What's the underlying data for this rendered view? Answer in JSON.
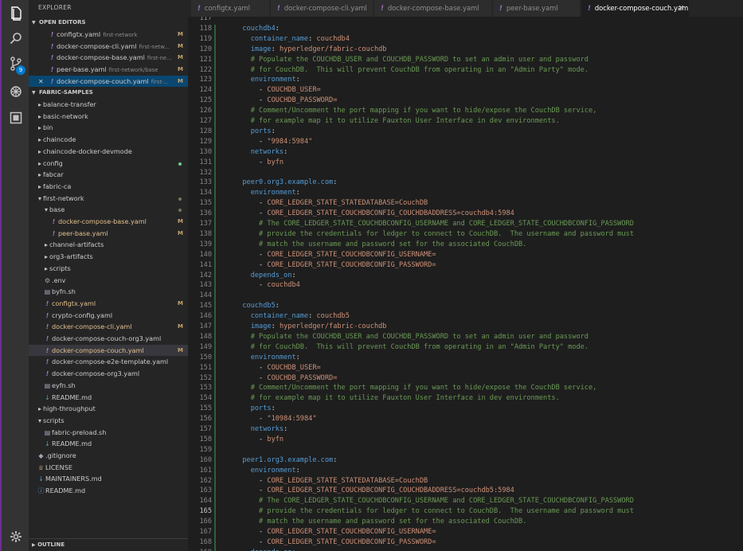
{
  "activity_bar": {
    "icons": [
      "files-icon",
      "search-icon",
      "source-control-icon",
      "debug-icon",
      "extensions-icon",
      "settings-icon"
    ],
    "scm_badge": "9"
  },
  "sidebar": {
    "title": "EXPLORER",
    "open_editors_title": "OPEN EDITORS",
    "workspace_title": "FABRIC-SAMPLES",
    "outline_title": "OUTLINE",
    "open_editors": [
      {
        "name": "configtx.yaml",
        "desc": "first-network",
        "mark": "M"
      },
      {
        "name": "docker-compose-cli.yaml",
        "desc": "first-netw...",
        "mark": "M"
      },
      {
        "name": "docker-compose-base.yaml",
        "desc": "first-ne...",
        "mark": "M"
      },
      {
        "name": "peer-base.yaml",
        "desc": "first-network/base",
        "mark": "M"
      },
      {
        "name": "docker-compose-couch.yaml",
        "desc": "first-...",
        "mark": "M"
      }
    ],
    "tree": [
      {
        "label": "balance-transfer",
        "type": "folder",
        "depth": 0,
        "tw": "›"
      },
      {
        "label": "basic-network",
        "type": "folder",
        "depth": 0,
        "tw": "›"
      },
      {
        "label": "bin",
        "type": "folder",
        "depth": 0,
        "tw": "›"
      },
      {
        "label": "chaincode",
        "type": "folder",
        "depth": 0,
        "tw": "›"
      },
      {
        "label": "chaincode-docker-devmode",
        "type": "folder",
        "depth": 0,
        "tw": "›"
      },
      {
        "label": "config",
        "type": "folder",
        "depth": 0,
        "tw": "›",
        "dot": "green"
      },
      {
        "label": "fabcar",
        "type": "folder",
        "depth": 0,
        "tw": "›"
      },
      {
        "label": "fabric-ca",
        "type": "folder",
        "depth": 0,
        "tw": "›"
      },
      {
        "label": "first-network",
        "type": "folder",
        "depth": 0,
        "tw": "⌄",
        "dot": "plain"
      },
      {
        "label": "base",
        "type": "folder",
        "depth": 1,
        "tw": "⌄",
        "dot": "plain"
      },
      {
        "label": "docker-compose-base.yaml",
        "type": "yaml",
        "depth": 2,
        "mark": "M"
      },
      {
        "label": "peer-base.yaml",
        "type": "yaml",
        "depth": 2,
        "mark": "M"
      },
      {
        "label": "channel-artifacts",
        "type": "folder",
        "depth": 1,
        "tw": "›"
      },
      {
        "label": "org3-artifacts",
        "type": "folder",
        "depth": 1,
        "tw": "›"
      },
      {
        "label": "scripts",
        "type": "folder",
        "depth": 1,
        "tw": "›"
      },
      {
        "label": ".env",
        "type": "gear",
        "depth": 1
      },
      {
        "label": "byfn.sh",
        "type": "file",
        "depth": 1
      },
      {
        "label": "configtx.yaml",
        "type": "yaml",
        "depth": 1,
        "mark": "M"
      },
      {
        "label": "crypto-config.yaml",
        "type": "yaml",
        "depth": 1
      },
      {
        "label": "docker-compose-cli.yaml",
        "type": "yaml",
        "depth": 1,
        "mark": "M"
      },
      {
        "label": "docker-compose-couch-org3.yaml",
        "type": "yaml",
        "depth": 1
      },
      {
        "label": "docker-compose-couch.yaml",
        "type": "yaml",
        "depth": 1,
        "mark": "M",
        "selected": true
      },
      {
        "label": "docker-compose-e2e-template.yaml",
        "type": "yaml",
        "depth": 1
      },
      {
        "label": "docker-compose-org3.yaml",
        "type": "yaml",
        "depth": 1
      },
      {
        "label": "eyfn.sh",
        "type": "file",
        "depth": 1
      },
      {
        "label": "README.md",
        "type": "md",
        "depth": 1
      },
      {
        "label": "high-throughput",
        "type": "folder",
        "depth": 0,
        "tw": "›"
      },
      {
        "label": "scripts",
        "type": "folder",
        "depth": 0,
        "tw": "⌄"
      },
      {
        "label": "fabric-preload.sh",
        "type": "file",
        "depth": 1
      },
      {
        "label": "README.md",
        "type": "md",
        "depth": 1
      },
      {
        "label": ".gitignore",
        "type": "git",
        "depth": 0
      },
      {
        "label": "LICENSE",
        "type": "lic",
        "depth": 0
      },
      {
        "label": "MAINTAINERS.md",
        "type": "md",
        "depth": 0
      },
      {
        "label": "README.md",
        "type": "info",
        "depth": 0
      }
    ]
  },
  "tabs": [
    {
      "label": "configtx.yaml",
      "active": false
    },
    {
      "label": "docker-compose-cli.yaml",
      "active": false
    },
    {
      "label": "docker-compose-base.yaml",
      "active": false
    },
    {
      "label": "peer-base.yaml",
      "active": false
    },
    {
      "label": "docker-compose-couch.yaml",
      "active": true,
      "close": "×"
    }
  ],
  "editor": {
    "first_line": 117,
    "current_line": 165,
    "lines": [
      "",
      "  couchdb4:",
      "    container_name: couchdb4",
      "    image: hyperledger/fabric-couchdb",
      "    # Populate the COUCHDB_USER and COUCHDB_PASSWORD to set an admin user and password",
      "    # for CouchDB.  This will prevent CouchDB from operating in an \"Admin Party\" mode.",
      "    environment:",
      "      - COUCHDB_USER=",
      "      - COUCHDB_PASSWORD=",
      "    # Comment/Uncomment the port mapping if you want to hide/expose the CouchDB service,",
      "    # for example map it to utilize Fauxton User Interface in dev environments.",
      "    ports:",
      "      - \"9984:5984\"",
      "    networks:",
      "      - byfn",
      "",
      "  peer0.org3.example.com:",
      "    environment:",
      "      - CORE_LEDGER_STATE_STATEDATABASE=CouchDB",
      "      - CORE_LEDGER_STATE_COUCHDBCONFIG_COUCHDBADDRESS=couchdb4:5984",
      "      # The CORE_LEDGER_STATE_COUCHDBCONFIG_USERNAME and CORE_LEDGER_STATE_COUCHDBCONFIG_PASSWORD",
      "      # provide the credentials for ledger to connect to CouchDB.  The username and password must",
      "      # match the username and password set for the associated CouchDB.",
      "      - CORE_LEDGER_STATE_COUCHDBCONFIG_USERNAME=",
      "      - CORE_LEDGER_STATE_COUCHDBCONFIG_PASSWORD=",
      "    depends_on:",
      "      - couchdb4",
      "",
      "  couchdb5:",
      "    container_name: couchdb5",
      "    image: hyperledger/fabric-couchdb",
      "    # Populate the COUCHDB_USER and COUCHDB_PASSWORD to set an admin user and password",
      "    # for CouchDB.  This will prevent CouchDB from operating in an \"Admin Party\" mode.",
      "    environment:",
      "      - COUCHDB_USER=",
      "      - COUCHDB_PASSWORD=",
      "    # Comment/Uncomment the port mapping if you want to hide/expose the CouchDB service,",
      "    # for example map it to utilize Fauxton User Interface in dev environments.",
      "    ports:",
      "      - \"10984:5984\"",
      "    networks:",
      "      - byfn",
      "",
      "  peer1.org3.example.com:",
      "    environment:",
      "      - CORE_LEDGER_STATE_STATEDATABASE=CouchDB",
      "      - CORE_LEDGER_STATE_COUCHDBCONFIG_COUCHDBADDRESS=couchdb5:5984",
      "      # The CORE_LEDGER_STATE_COUCHDBCONFIG_USERNAME and CORE_LEDGER_STATE_COUCHDBCONFIG_PASSWORD",
      "      # provide the credentials for ledger to connect to CouchDB.  The username and password must",
      "      # match the username and password set for the associated CouchDB.",
      "      - CORE_LEDGER_STATE_COUCHDBCONFIG_USERNAME=",
      "      - CORE_LEDGER_STATE_COUCHDBCONFIG_PASSWORD=",
      "    depends_on:"
    ]
  }
}
